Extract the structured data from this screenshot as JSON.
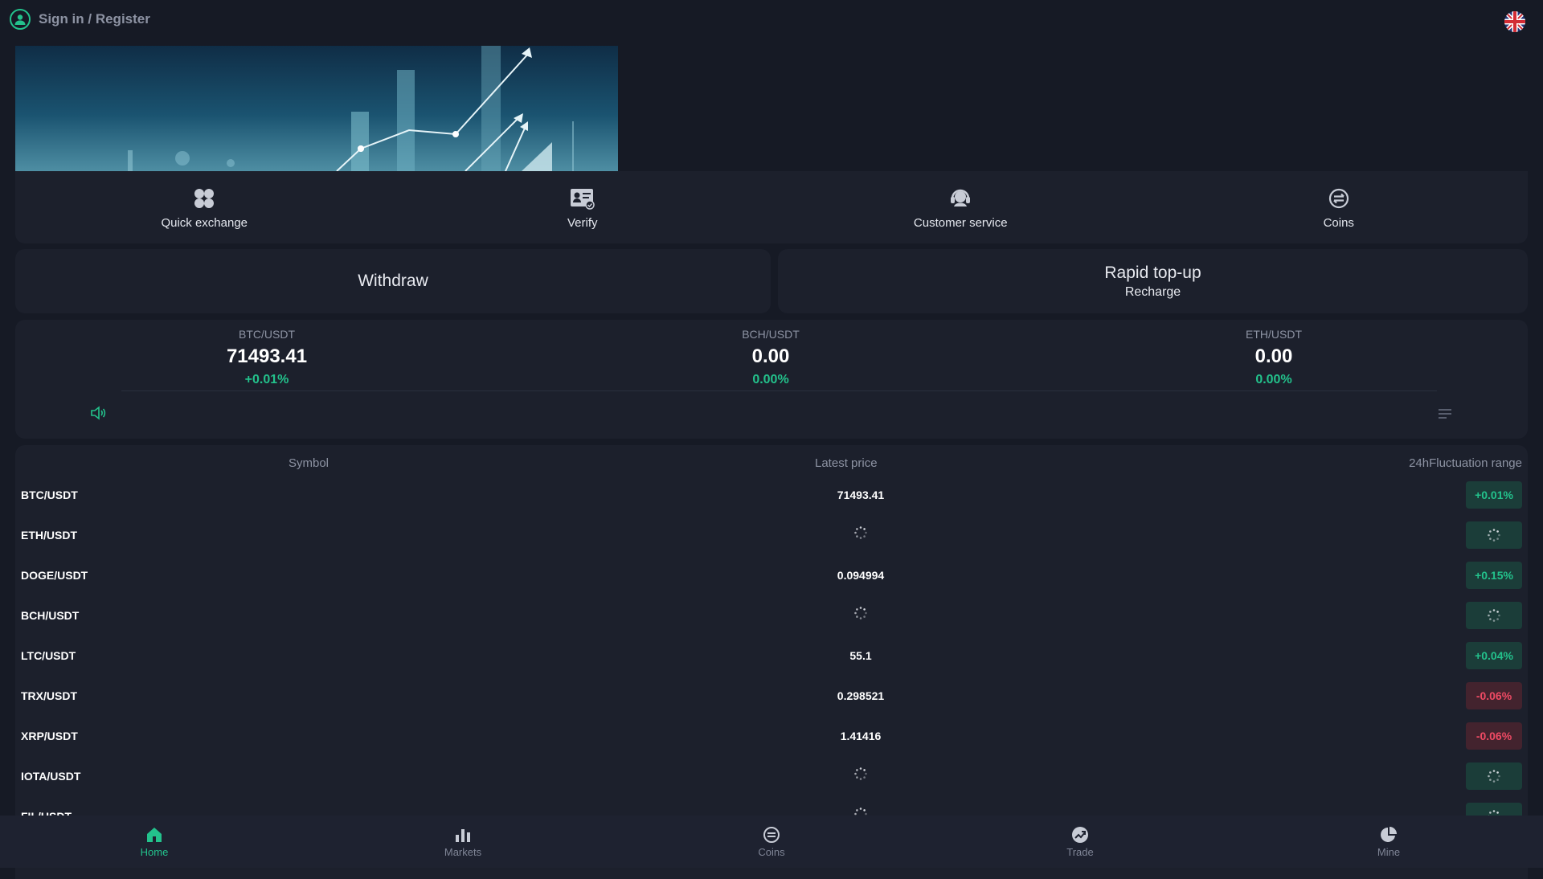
{
  "header": {
    "signin_label": "Sign in / Register",
    "avatar_icon": "user-circle-icon",
    "language_icon": "uk-flag-icon",
    "accent": "#23c28c"
  },
  "quick_actions": [
    {
      "label": "Quick exchange",
      "icon": "grid-icon"
    },
    {
      "label": "Verify",
      "icon": "id-card-icon"
    },
    {
      "label": "Customer service",
      "icon": "headset-icon"
    },
    {
      "label": "Coins",
      "icon": "coin-icon"
    }
  ],
  "withdraw": {
    "label": "Withdraw"
  },
  "rapid_topup": {
    "title": "Rapid top-up",
    "subtitle": "Recharge"
  },
  "tickers": [
    {
      "pair": "BTC/USDT",
      "price": "71493.41",
      "change": "+0.01%"
    },
    {
      "pair": "BCH/USDT",
      "price": "0.00",
      "change": "0.00%"
    },
    {
      "pair": "ETH/USDT",
      "price": "0.00",
      "change": "0.00%"
    }
  ],
  "market": {
    "headers": {
      "symbol": "Symbol",
      "price": "Latest price",
      "change": "24hFluctuation range"
    },
    "rows": [
      {
        "symbol": "BTC/USDT",
        "price": "71493.41",
        "change": "+0.01%",
        "trend": "up"
      },
      {
        "symbol": "ETH/USDT",
        "price": "",
        "change": "",
        "trend": "loading"
      },
      {
        "symbol": "DOGE/USDT",
        "price": "0.094994",
        "change": "+0.15%",
        "trend": "up"
      },
      {
        "symbol": "BCH/USDT",
        "price": "",
        "change": "",
        "trend": "loading"
      },
      {
        "symbol": "LTC/USDT",
        "price": "55.1",
        "change": "+0.04%",
        "trend": "up"
      },
      {
        "symbol": "TRX/USDT",
        "price": "0.298521",
        "change": "-0.06%",
        "trend": "down"
      },
      {
        "symbol": "XRP/USDT",
        "price": "1.41416",
        "change": "-0.06%",
        "trend": "down"
      },
      {
        "symbol": "IOTA/USDT",
        "price": "",
        "change": "",
        "trend": "loading"
      },
      {
        "symbol": "FIL/USDT",
        "price": "",
        "change": "",
        "trend": "loading"
      }
    ]
  },
  "nav": [
    {
      "label": "Home",
      "icon": "home-icon",
      "active": true
    },
    {
      "label": "Markets",
      "icon": "bar-chart-icon",
      "active": false
    },
    {
      "label": "Coins",
      "icon": "coin-icon",
      "active": false
    },
    {
      "label": "Trade",
      "icon": "trade-icon",
      "active": false
    },
    {
      "label": "Mine",
      "icon": "pie-chart-icon",
      "active": false
    }
  ]
}
